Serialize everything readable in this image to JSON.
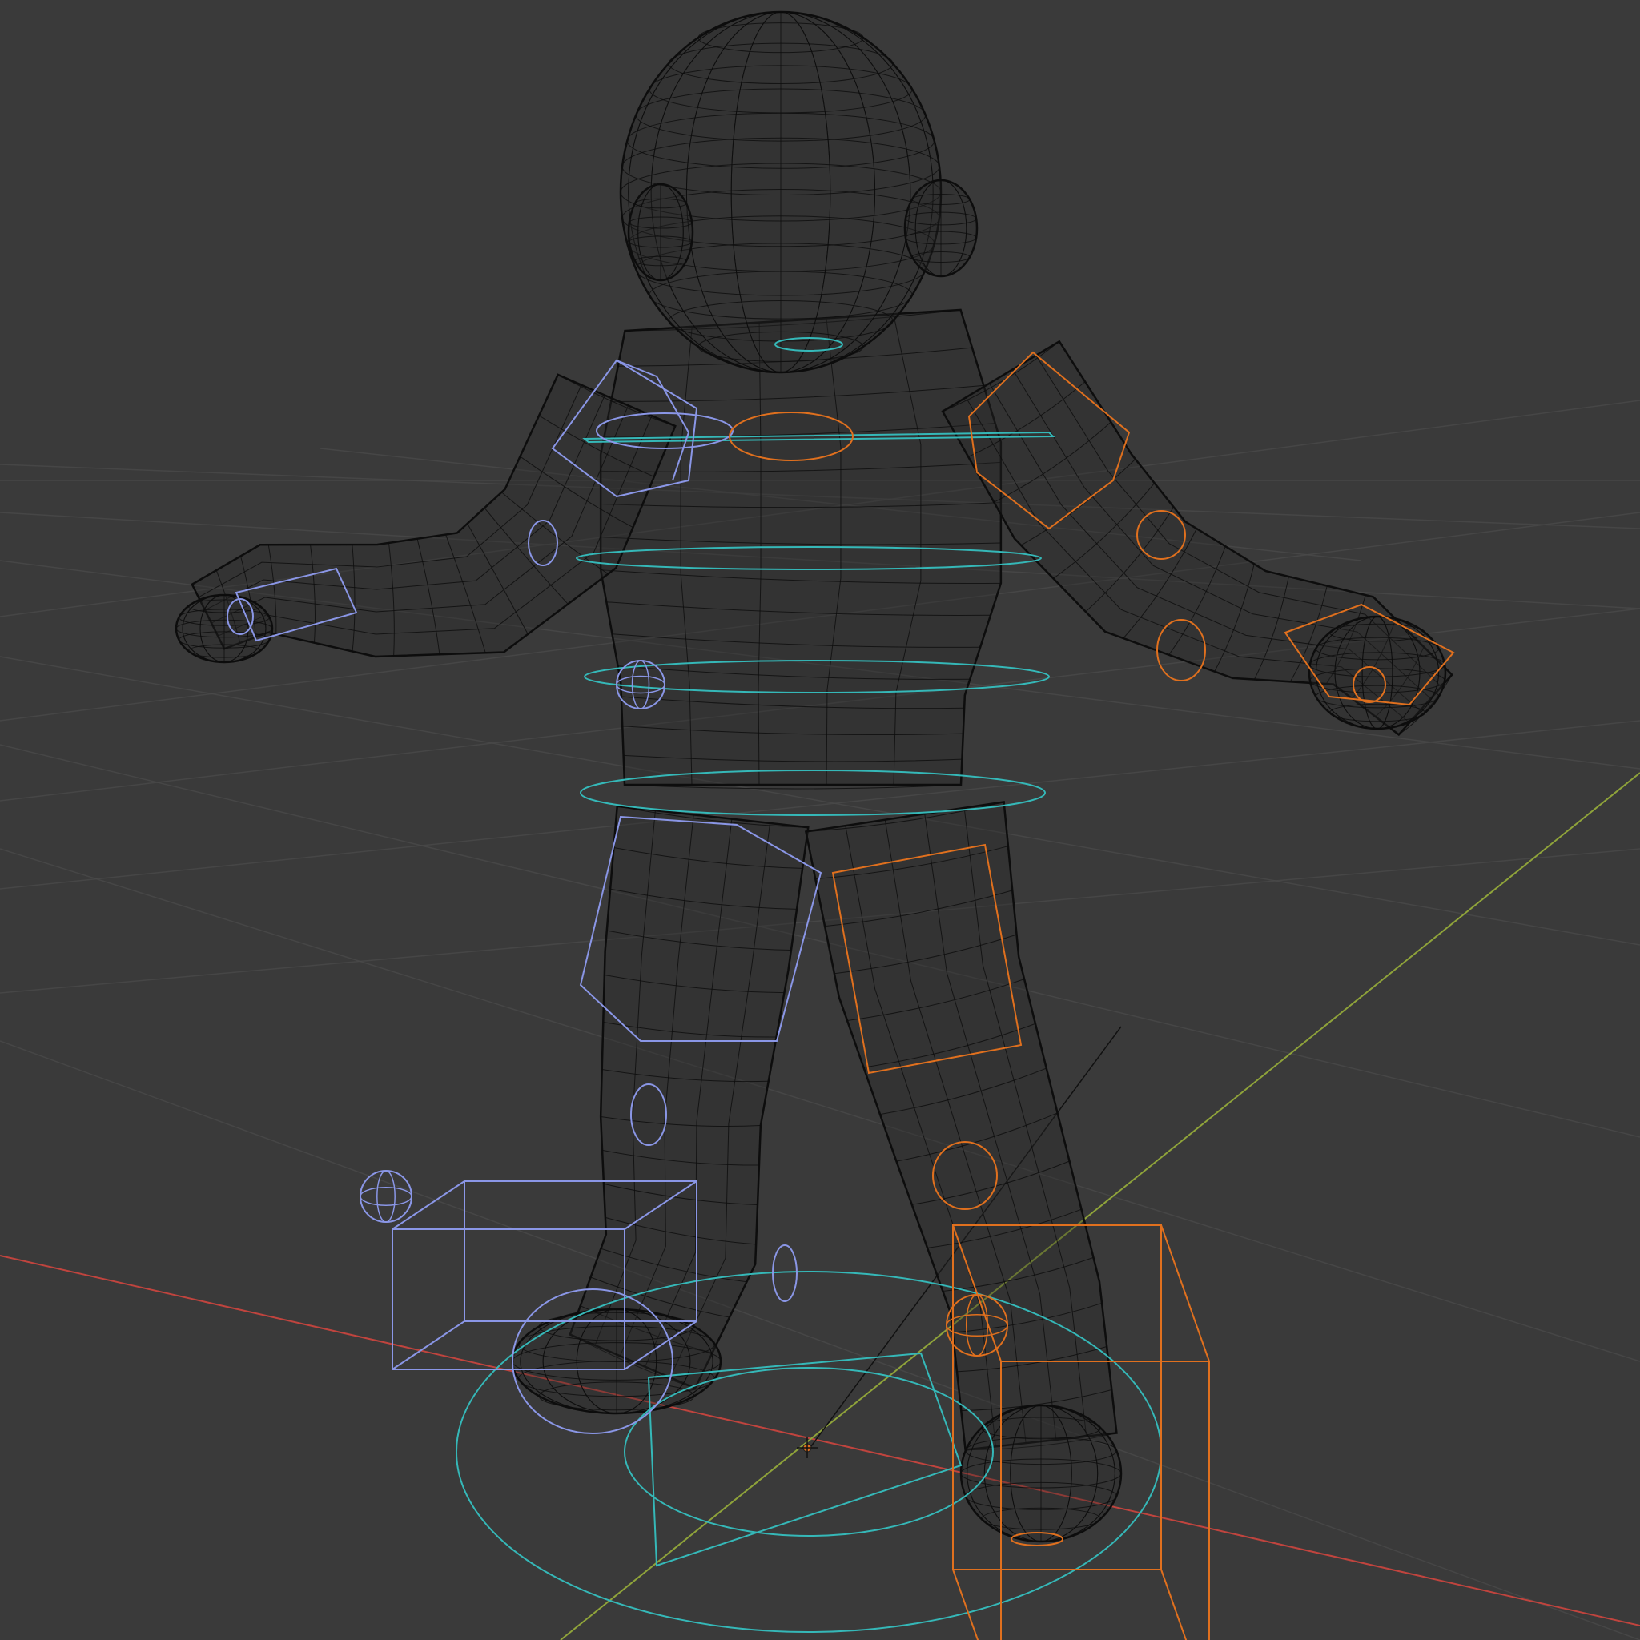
{
  "viewport": {
    "mode": "wireframe",
    "background_color": "#3a3a3a"
  },
  "colors": {
    "grid": "#4a4a4a",
    "x_axis": "#c0443e",
    "y_axis": "#8fa33a",
    "mesh_wire": "#0d0d0d",
    "control_center": "#35b8b8",
    "control_left": "#8a96e6",
    "control_right": "#e0701e"
  },
  "scene": {
    "objects": [
      {
        "name": "character-mesh",
        "type": "mesh"
      },
      {
        "name": "rig-controls",
        "type": "armature"
      },
      {
        "name": "world-origin",
        "type": "origin"
      }
    ]
  }
}
